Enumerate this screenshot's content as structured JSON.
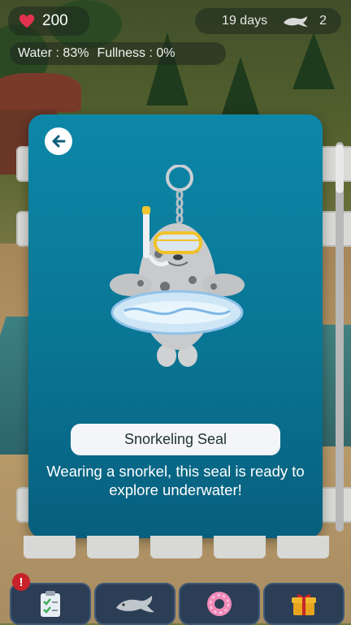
{
  "hud": {
    "hearts": "200",
    "days": "19 days",
    "seal_count": "2",
    "water_label": "Water : 83%",
    "fullness_label": "Fullness : 0%"
  },
  "item": {
    "name": "Snorkeling Seal",
    "description": "Wearing a snorkel, this seal is ready to explore underwater!"
  },
  "toolbar": {
    "alert_badge": "!",
    "buttons": [
      {
        "icon": "clipboard-icon"
      },
      {
        "icon": "seal-icon"
      },
      {
        "icon": "donut-icon"
      },
      {
        "icon": "gift-icon"
      }
    ]
  },
  "colors": {
    "card_bg": "#0a7594",
    "heart": "#e0324f",
    "alert": "#c8222a"
  }
}
